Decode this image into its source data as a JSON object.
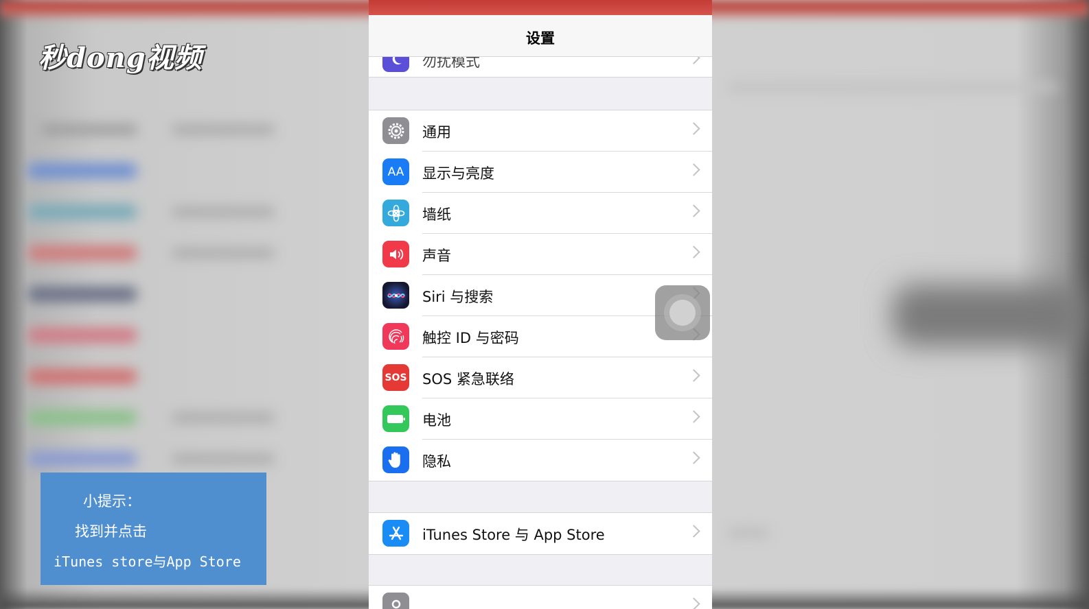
{
  "watermark": {
    "logo_text": "秒dong视频"
  },
  "navbar": {
    "title": "设置"
  },
  "partial_top_row": {
    "label": "勿扰模式"
  },
  "settings_group": [
    {
      "label": "通用",
      "icon": "gear-icon",
      "color": "#8e8e93"
    },
    {
      "label": "显示与亮度",
      "icon": "text-size-icon",
      "color": "#1a7cf5"
    },
    {
      "label": "墙纸",
      "icon": "flower-icon",
      "color": "#34aadc"
    },
    {
      "label": "声音",
      "icon": "speaker-icon",
      "color": "#f03a4a"
    },
    {
      "label": "Siri 与搜索",
      "icon": "siri-icon",
      "color": "#1d1d3b"
    },
    {
      "label": "触控 ID 与密码",
      "icon": "fingerprint-icon",
      "color": "#f0385a"
    },
    {
      "label": "SOS 紧急联络",
      "icon": "sos-icon",
      "color": "#e53935"
    },
    {
      "label": "电池",
      "icon": "battery-icon",
      "color": "#34c759"
    },
    {
      "label": "隐私",
      "icon": "hand-icon",
      "color": "#1a6ff0"
    }
  ],
  "store_row": {
    "label": "iTunes Store 与 App Store",
    "icon": "app-store-icon",
    "color": "#1a8cf5"
  },
  "sos_icon_text": "SOS",
  "aa_icon_text": "AA",
  "tip": {
    "line1": "小提示：",
    "line2": "找到并点击",
    "line3": "iTunes store与App Store"
  }
}
